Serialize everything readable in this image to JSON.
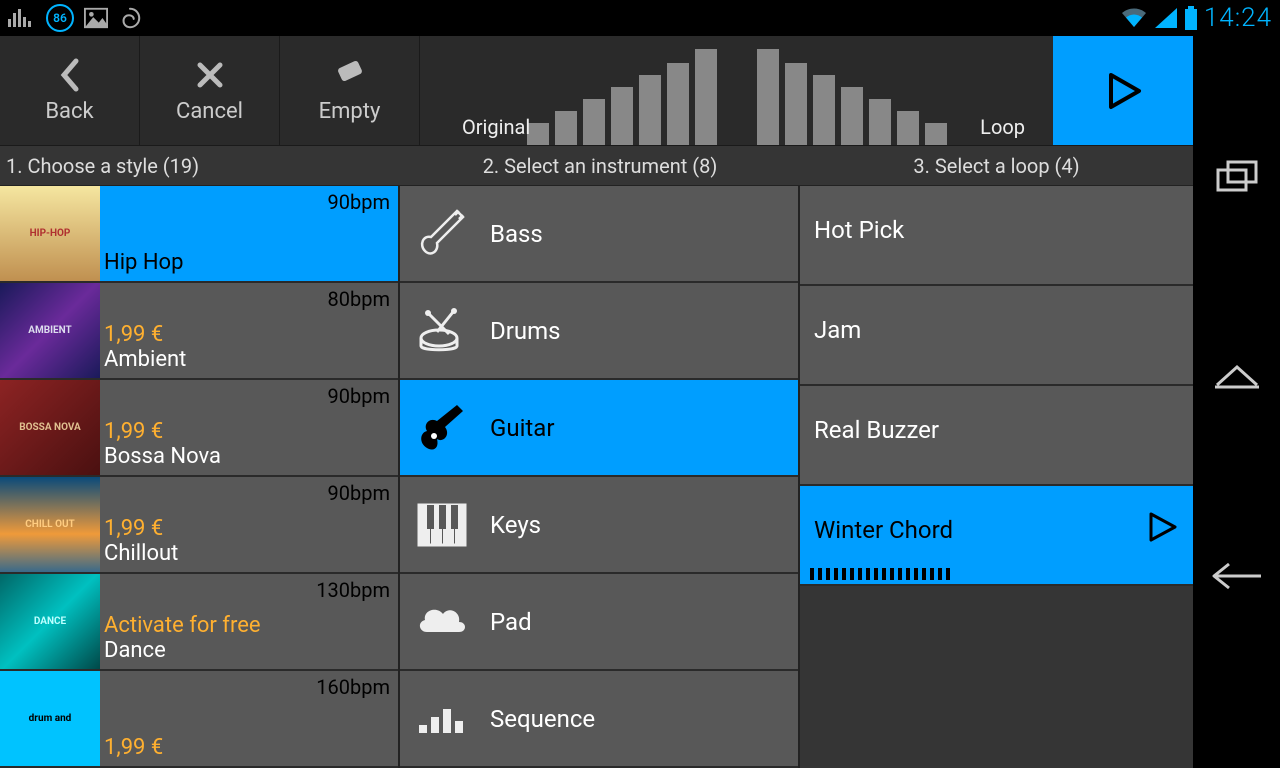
{
  "status": {
    "badge": "86",
    "time": "14:24"
  },
  "toolbar": {
    "back": "Back",
    "cancel": "Cancel",
    "empty": "Empty",
    "original_label": "Original",
    "loop_label": "Loop"
  },
  "steps": {
    "style": "1. Choose a style (19)",
    "instrument": "2. Select an instrument (8)",
    "loop": "3. Select a loop (4)"
  },
  "styles": [
    {
      "name": "Hip Hop",
      "price": "",
      "bpm": "90bpm",
      "selected": true,
      "thumb": "hiphop",
      "thumb_text": "HIP-HOP"
    },
    {
      "name": "Ambient",
      "price": "1,99 €",
      "bpm": "80bpm",
      "selected": false,
      "thumb": "ambient",
      "thumb_text": "AMBIENT"
    },
    {
      "name": "Bossa Nova",
      "price": "1,99 €",
      "bpm": "90bpm",
      "selected": false,
      "thumb": "bossa",
      "thumb_text": "BOSSA NOVA"
    },
    {
      "name": "Chillout",
      "price": "1,99 €",
      "bpm": "90bpm",
      "selected": false,
      "thumb": "chill",
      "thumb_text": "CHILL OUT"
    },
    {
      "name": "Dance",
      "price": "Activate for free",
      "bpm": "130bpm",
      "selected": false,
      "thumb": "dance",
      "thumb_text": "DANCE"
    },
    {
      "name": "",
      "price": "1,99 €",
      "bpm": "160bpm",
      "selected": false,
      "thumb": "drum",
      "thumb_text": "drum and"
    }
  ],
  "instruments": [
    {
      "name": "Bass",
      "icon": "bass",
      "selected": false
    },
    {
      "name": "Drums",
      "icon": "drums",
      "selected": false
    },
    {
      "name": "Guitar",
      "icon": "guitar",
      "selected": true
    },
    {
      "name": "Keys",
      "icon": "keys",
      "selected": false
    },
    {
      "name": "Pad",
      "icon": "pad",
      "selected": false
    },
    {
      "name": "Sequence",
      "icon": "sequence",
      "selected": false
    }
  ],
  "loops": [
    {
      "name": "Hot Pick",
      "selected": false
    },
    {
      "name": "Jam",
      "selected": false
    },
    {
      "name": "Real Buzzer",
      "selected": false
    },
    {
      "name": "Winter Chord",
      "selected": true
    }
  ],
  "bar_heights": {
    "original": [
      22,
      34,
      46,
      58,
      70,
      82,
      96
    ],
    "loop": [
      96,
      82,
      70,
      58,
      46,
      34,
      22
    ]
  }
}
